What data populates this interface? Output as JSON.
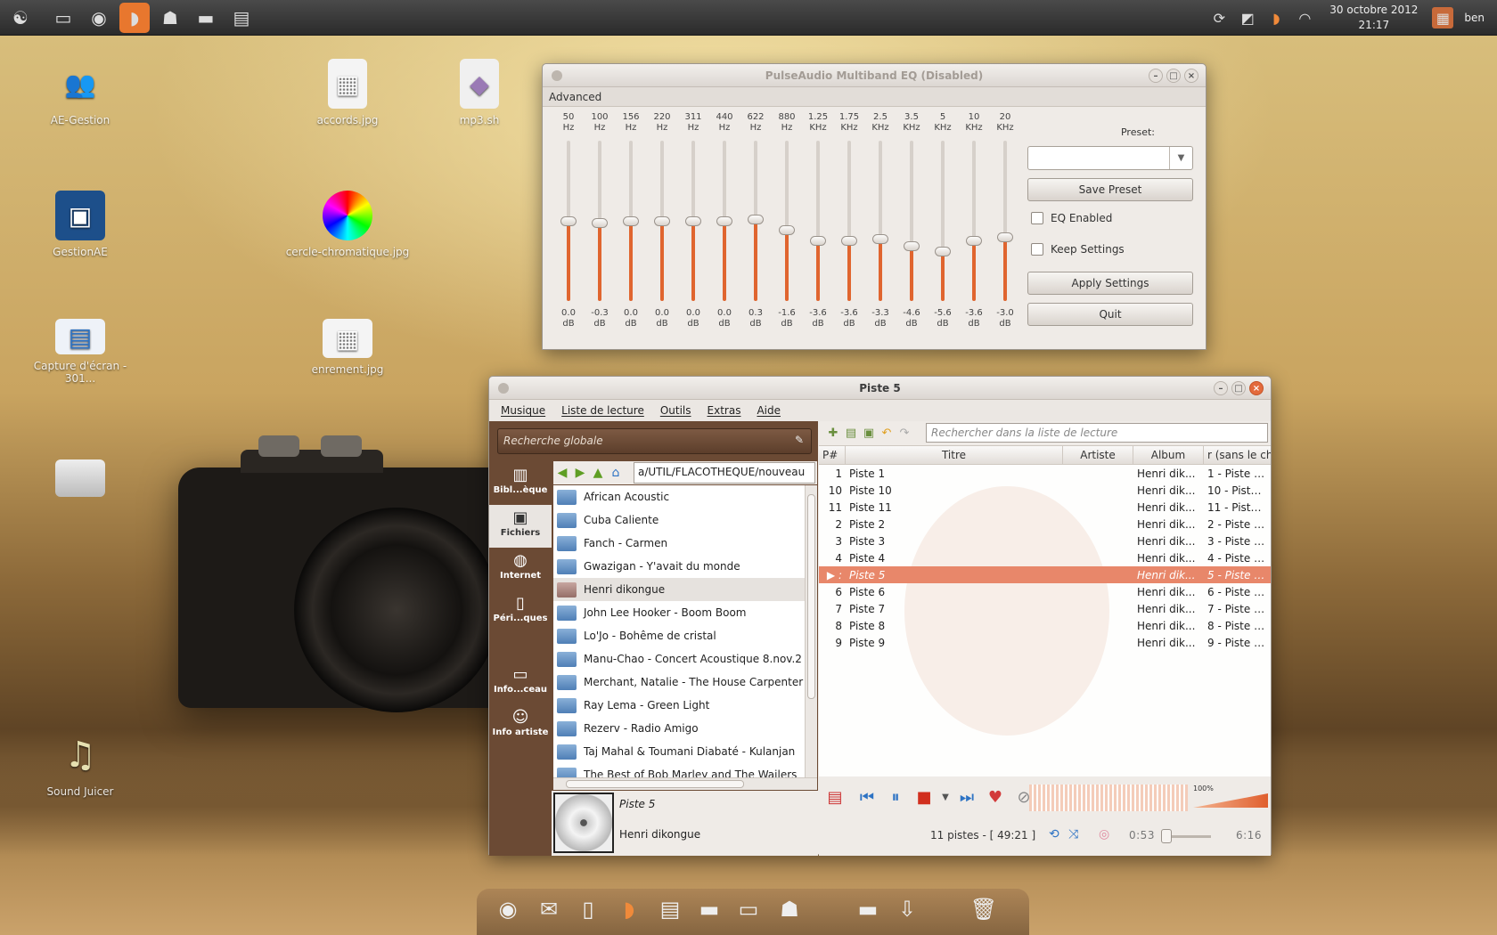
{
  "panel": {
    "date": "30 octobre 2012",
    "time": "21:17",
    "user": "ben"
  },
  "desktop": [
    {
      "label": "AE-Gestion"
    },
    {
      "label": "accords.jpg"
    },
    {
      "label": "mp3.sh"
    },
    {
      "label": "GestionAE"
    },
    {
      "label": "cercle-chromatique.jpg"
    },
    {
      "label": "Capture d'écran - 301..."
    },
    {
      "label": "enrement.jpg"
    },
    {
      "label": ""
    },
    {
      "label": "Sound Juicer"
    }
  ],
  "eq": {
    "title": "PulseAudio Multiband EQ (Disabled)",
    "section": "Advanced",
    "unit": "dB",
    "preset_label": "Preset:",
    "save_preset": "Save Preset",
    "eq_enabled": "EQ Enabled",
    "keep_settings": "Keep Settings",
    "apply_settings": "Apply Settings",
    "quit": "Quit",
    "bands": [
      {
        "freq": "50",
        "unit": "Hz",
        "gain": 0.0,
        "gain_label": "0.0"
      },
      {
        "freq": "100",
        "unit": "Hz",
        "gain": -0.3,
        "gain_label": "-0.3"
      },
      {
        "freq": "156",
        "unit": "Hz",
        "gain": 0.0,
        "gain_label": "0.0"
      },
      {
        "freq": "220",
        "unit": "Hz",
        "gain": 0.0,
        "gain_label": "0.0"
      },
      {
        "freq": "311",
        "unit": "Hz",
        "gain": 0.0,
        "gain_label": "0.0"
      },
      {
        "freq": "440",
        "unit": "Hz",
        "gain": 0.0,
        "gain_label": "0.0"
      },
      {
        "freq": "622",
        "unit": "Hz",
        "gain": 0.3,
        "gain_label": "0.3"
      },
      {
        "freq": "880",
        "unit": "Hz",
        "gain": -1.6,
        "gain_label": "-1.6"
      },
      {
        "freq": "1.25",
        "unit": "KHz",
        "gain": -3.6,
        "gain_label": "-3.6"
      },
      {
        "freq": "1.75",
        "unit": "KHz",
        "gain": -3.6,
        "gain_label": "-3.6"
      },
      {
        "freq": "2.5",
        "unit": "KHz",
        "gain": -3.3,
        "gain_label": "-3.3"
      },
      {
        "freq": "3.5",
        "unit": "KHz",
        "gain": -4.6,
        "gain_label": "-4.6"
      },
      {
        "freq": "5",
        "unit": "KHz",
        "gain": -5.6,
        "gain_label": "-5.6"
      },
      {
        "freq": "10",
        "unit": "KHz",
        "gain": -3.6,
        "gain_label": "-3.6"
      },
      {
        "freq": "20",
        "unit": "KHz",
        "gain": -3.0,
        "gain_label": "-3.0"
      }
    ]
  },
  "player": {
    "title": "Piste 5",
    "menu": [
      "Musique",
      "Liste de lecture",
      "Outils",
      "Extras",
      "Aide"
    ],
    "global_search": "Recherche globale",
    "sidebar": [
      "Bibl...èque",
      "Fichiers",
      "Internet",
      "Péri...ques",
      "Info...ceau",
      "Info artiste"
    ],
    "path": "a/UTIL/FLACOTHEQUE/nouveau",
    "folders": [
      "African Acoustic",
      "Cuba Caliente",
      "Fanch - Carmen",
      "Gwazigan - Y'avait du monde",
      "Henri dikongue",
      "John Lee Hooker - Boom Boom",
      "Lo'Jo - Bohême de cristal",
      "Manu-Chao - Concert Acoustique 8.nov.2",
      "Merchant, Natalie - The House Carpenter",
      "Ray Lema - Green Light",
      "Rezerv - Radio Amigo",
      "Taj Mahal & Toumani Diabaté - Kulanjan",
      "The Best of Bob Marley and The Wailers"
    ],
    "now_playing": {
      "title": "Piste 5",
      "artist": "Henri dikongue"
    },
    "playlist_search": "Rechercher dans la liste de lecture",
    "columns": [
      "P#",
      "Titre",
      "Artiste",
      "Album",
      "r (sans le ch"
    ],
    "rows": [
      {
        "n": "1",
        "title": "Piste 1",
        "artist": "",
        "album": "Henri dik...",
        "sort": "1 - Piste 1...."
      },
      {
        "n": "10",
        "title": "Piste 10",
        "artist": "",
        "album": "Henri dik...",
        "sort": "10 - Piste ..."
      },
      {
        "n": "11",
        "title": "Piste 11",
        "artist": "",
        "album": "Henri dik...",
        "sort": "11 - Piste ..."
      },
      {
        "n": "2",
        "title": "Piste 2",
        "artist": "",
        "album": "Henri dik...",
        "sort": "2 - Piste 2...."
      },
      {
        "n": "3",
        "title": "Piste 3",
        "artist": "",
        "album": "Henri dik...",
        "sort": "3 - Piste 3...."
      },
      {
        "n": "4",
        "title": "Piste 4",
        "artist": "",
        "album": "Henri dik...",
        "sort": "4 - Piste 4...."
      },
      {
        "n": "▶ :",
        "title": "Piste 5",
        "artist": "",
        "album": "Henri dik...",
        "sort": "5 - Piste 5...."
      },
      {
        "n": "6",
        "title": "Piste 6",
        "artist": "",
        "album": "Henri dik...",
        "sort": "6 - Piste 6...."
      },
      {
        "n": "7",
        "title": "Piste 7",
        "artist": "",
        "album": "Henri dik...",
        "sort": "7 - Piste 7...."
      },
      {
        "n": "8",
        "title": "Piste 8",
        "artist": "",
        "album": "Henri dik...",
        "sort": "8 - Piste 8...."
      },
      {
        "n": "9",
        "title": "Piste 9",
        "artist": "",
        "album": "Henri dik...",
        "sort": "9 - Piste 9...."
      }
    ],
    "volume_label": "100%",
    "status": "11 pistes - [ 49:21 ]",
    "elapsed": "0:53",
    "total": "6:16"
  },
  "colors": {
    "accent": "#e8772e",
    "selected_row": "#e8876a"
  }
}
